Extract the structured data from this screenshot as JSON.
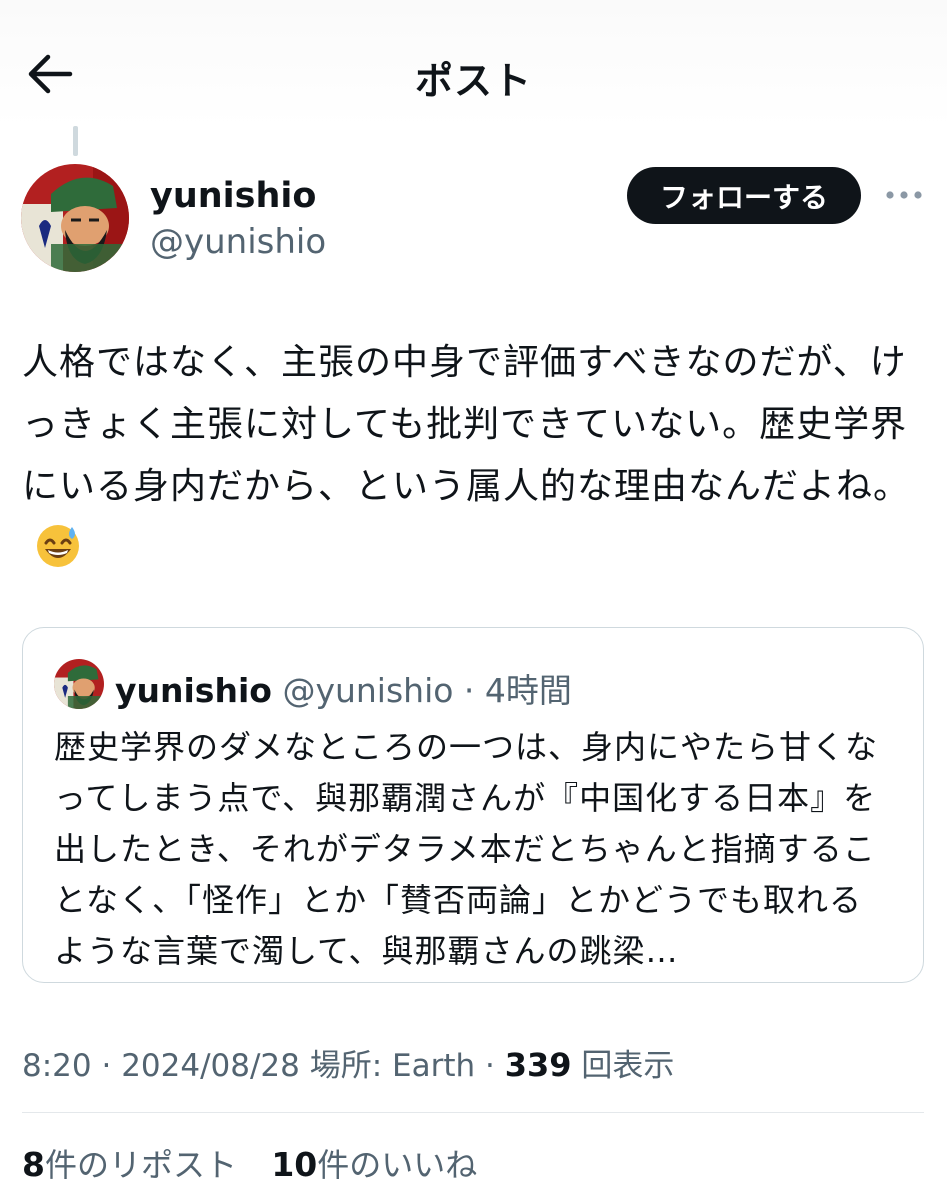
{
  "header": {
    "title": "ポスト",
    "back_icon": "arrow-left-icon"
  },
  "author": {
    "display_name": "yunishio",
    "handle": "@yunishio",
    "follow_label": "フォローする",
    "more_icon": "more-horizontal-icon"
  },
  "post": {
    "text": "人格ではなく、主張の中身で評価すべきなのだが、けっきょく主張に対しても批判できていない。歴史学界にいる身内だから、という属人的な理由なんだよね。",
    "emoji": "grinning-face-with-sweat-emoji"
  },
  "quote": {
    "display_name": "yunishio",
    "handle": "@yunishio",
    "separator": " · ",
    "time": "4時間",
    "text": "歴史学界のダメなところの一つは、身内にやたら甘くなってしまう点で、與那覇潤さんが『中国化する日本』を出したとき、それがデタラメ本だとちゃんと指摘することなく、「怪作」とか「賛否両論」とかどうでも取れるような言葉で濁して、與那覇さんの跳梁…"
  },
  "meta": {
    "time": "8:20",
    "sep1": " · ",
    "date": "2024/08/28",
    "location_label": "場所: Earth",
    "sep2": " · ",
    "views_count": "339",
    "views_label": "回表示"
  },
  "stats": {
    "reposts_count": "8",
    "reposts_label": "件のリポスト",
    "likes_count": "10",
    "likes_label": "件のいいね"
  },
  "colors": {
    "text_primary": "#0f1419",
    "text_secondary": "#536471",
    "border": "#cfd9de",
    "button_bg": "#0f1419"
  }
}
